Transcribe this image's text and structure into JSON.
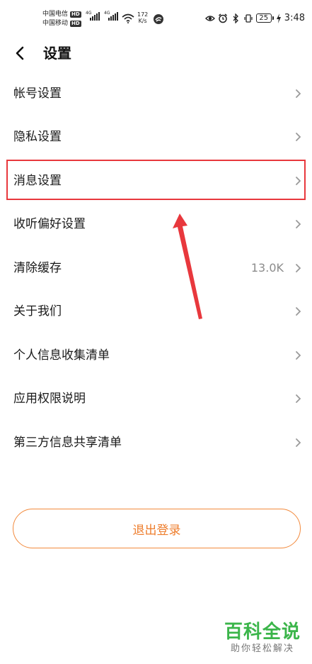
{
  "status_bar": {
    "carrier_1": "中国电信",
    "carrier_2": "中国移动",
    "hd_badge": "HD",
    "network_tag_1": "4G",
    "network_tag_2": "4G",
    "net_speed_value": "172",
    "net_speed_unit": "K/s",
    "battery_level": "25",
    "time": "3:48",
    "icons": [
      "eye-icon",
      "alarm-icon",
      "bluetooth-icon",
      "vibrate-icon",
      "charging-icon",
      "wifi-icon"
    ]
  },
  "header": {
    "title": "设置",
    "back_icon": "chevron-left-icon"
  },
  "settings": {
    "items": [
      {
        "label": "帐号设置",
        "value": ""
      },
      {
        "label": "隐私设置",
        "value": ""
      },
      {
        "label": "消息设置",
        "value": ""
      },
      {
        "label": "收听偏好设置",
        "value": ""
      },
      {
        "label": "清除缓存",
        "value": "13.0K"
      },
      {
        "label": "关于我们",
        "value": ""
      },
      {
        "label": "个人信息收集清单",
        "value": ""
      },
      {
        "label": "应用权限说明",
        "value": ""
      },
      {
        "label": "第三方信息共享清单",
        "value": ""
      }
    ],
    "highlighted_item": "消息设置"
  },
  "logout": {
    "label": "退出登录"
  },
  "watermark": {
    "main": "百科全说",
    "sub": "助你轻松解决"
  },
  "colors": {
    "accent": "#ee7d2c",
    "highlight": "#e8383d",
    "watermark_green": "#3bb54a",
    "chevron": "#9a9a9a",
    "value_text": "#8c8c8c"
  }
}
